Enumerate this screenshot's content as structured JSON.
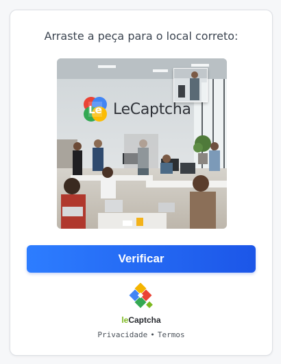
{
  "captcha": {
    "instruction": "Arraste a peça para o local correto:",
    "image_logo_text": "LeCaptcha",
    "verify_label": "Verificar",
    "brand_prefix": "le",
    "brand_suffix": "Captcha",
    "privacy_label": "Privacidade",
    "separator": "•",
    "terms_label": "Termos"
  },
  "colors": {
    "accent_start": "#2d7dff",
    "accent_end": "#1c56e8",
    "brand_green": "#7cb81f"
  },
  "icons": {
    "image_logo": "lecaptcha-logo-icon",
    "brand_mark": "lecaptcha-mark-icon"
  }
}
